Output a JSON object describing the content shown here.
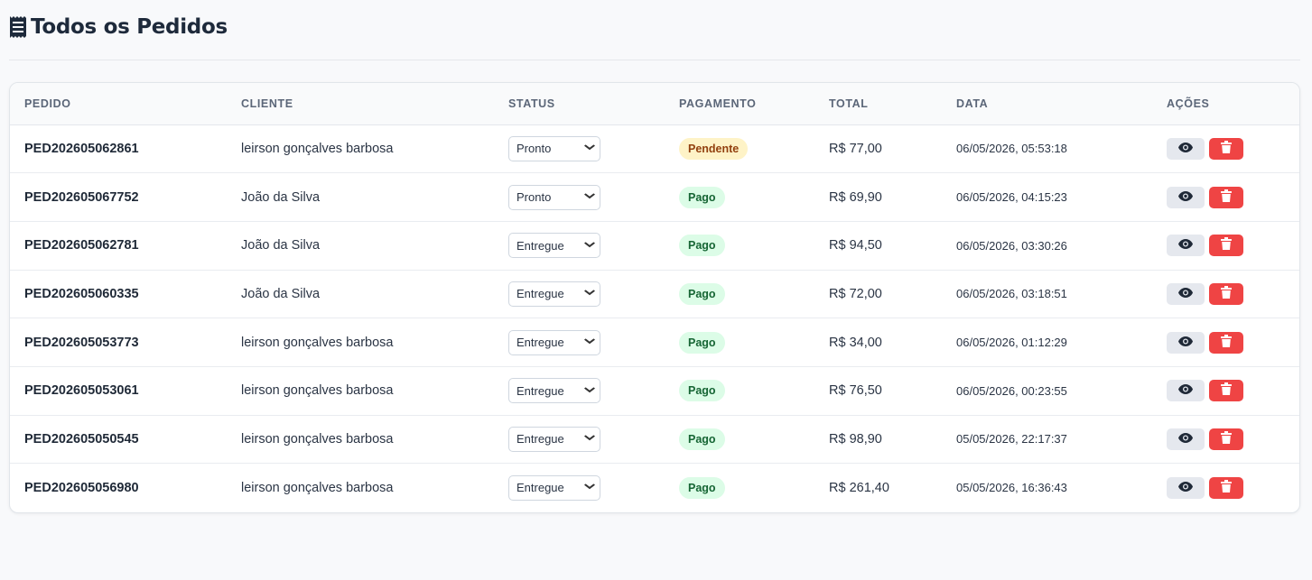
{
  "header": {
    "title": "Todos os Pedidos",
    "icon": "receipt-icon"
  },
  "table": {
    "columns": [
      "PEDIDO",
      "CLIENTE",
      "STATUS",
      "PAGAMENTO",
      "TOTAL",
      "DATA",
      "AÇÕES"
    ],
    "rows": [
      {
        "id": "PED202605062861",
        "client": "leirson gonçalves barbosa",
        "status": "Pronto",
        "payment": "Pendente",
        "total": "R$ 77,00",
        "date": "06/05/2026, 05:53:18"
      },
      {
        "id": "PED202605067752",
        "client": "João da Silva",
        "status": "Pronto",
        "payment": "Pago",
        "total": "R$ 69,90",
        "date": "06/05/2026, 04:15:23"
      },
      {
        "id": "PED202605062781",
        "client": "João da Silva",
        "status": "Entregue",
        "payment": "Pago",
        "total": "R$ 94,50",
        "date": "06/05/2026, 03:30:26"
      },
      {
        "id": "PED202605060335",
        "client": "João da Silva",
        "status": "Entregue",
        "payment": "Pago",
        "total": "R$ 72,00",
        "date": "06/05/2026, 03:18:51"
      },
      {
        "id": "PED202605053773",
        "client": "leirson gonçalves barbosa",
        "status": "Entregue",
        "payment": "Pago",
        "total": "R$ 34,00",
        "date": "06/05/2026, 01:12:29"
      },
      {
        "id": "PED202605053061",
        "client": "leirson gonçalves barbosa",
        "status": "Entregue",
        "payment": "Pago",
        "total": "R$ 76,50",
        "date": "06/05/2026, 00:23:55"
      },
      {
        "id": "PED202605050545",
        "client": "leirson gonçalves barbosa",
        "status": "Entregue",
        "payment": "Pago",
        "total": "R$ 98,90",
        "date": "05/05/2026, 22:17:37"
      },
      {
        "id": "PED202605056980",
        "client": "leirson gonçalves barbosa",
        "status": "Entregue",
        "payment": "Pago",
        "total": "R$ 261,40",
        "date": "05/05/2026, 16:36:43"
      }
    ]
  },
  "colors": {
    "paid_badge_bg": "#dcfce7",
    "paid_badge_text": "#166534",
    "pending_badge_bg": "#fef3c7",
    "pending_badge_text": "#92400e",
    "delete_button": "#ef4444",
    "view_button": "#e5e8ee"
  },
  "icons": {
    "view": "eye-icon",
    "delete": "trash-icon",
    "select": "chevron-down-icon"
  }
}
